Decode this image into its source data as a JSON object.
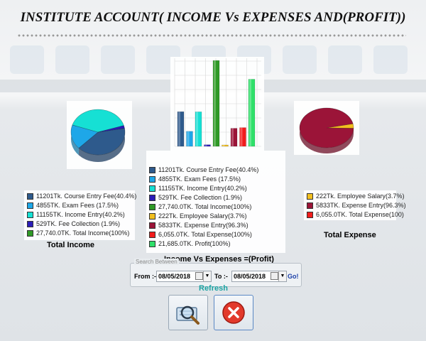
{
  "title": "INSTITUTE ACCOUNT( INCOME Vs EXPENSES AND(PROFIT))",
  "colors": {
    "course_fee": "#2e5a8c",
    "exam_fees": "#1ea7e8",
    "income_entry": "#16e0d4",
    "fee_collection": "#2a1db8",
    "total_income": "#2f9a26",
    "employee_salary": "#f2bf1f",
    "expense_entry": "#9b1438",
    "total_expense": "#f21c1c",
    "profit": "#2fe06a"
  },
  "income_legend": [
    {
      "text": "11201Tk.  Course Entry Fee(40.4%)",
      "color_key": "course_fee"
    },
    {
      "text": "4855TK.  Exam Fees (17.5%)",
      "color_key": "exam_fees"
    },
    {
      "text": "11155TK.  Income Entry(40.2%)",
      "color_key": "income_entry"
    },
    {
      "text": "529TK.  Fee Collection (1.9%)",
      "color_key": "fee_collection"
    },
    {
      "text": "27,740.0TK.  Total Income(100%)",
      "color_key": "total_income"
    }
  ],
  "income_title": "Total Income",
  "center_legend": [
    {
      "text": "11201Tk.  Course Entry Fee(40.4%)",
      "color_key": "course_fee"
    },
    {
      "text": "4855TK.  Exam Fees (17.5%)",
      "color_key": "exam_fees"
    },
    {
      "text": "11155TK.  Income Entry(40.2%)",
      "color_key": "income_entry"
    },
    {
      "text": "529TK.  Fee Collection (1.9%)",
      "color_key": "fee_collection"
    },
    {
      "text": "27,740.0TK.  Total Income(100%)",
      "color_key": "total_income"
    },
    {
      "text": "222Tk.  Employee Salary(3.7%)",
      "color_key": "employee_salary"
    },
    {
      "text": "5833TK.  Expense Entry(96.3%)",
      "color_key": "expense_entry"
    },
    {
      "text": "6,055.0TK.  Total Expense(100%)",
      "color_key": "total_expense"
    },
    {
      "text": "21,685.0TK.  Profit(100%)",
      "color_key": "profit"
    }
  ],
  "center_title": "Income Vs Expenses =(Profit)",
  "expense_legend": [
    {
      "text": "222Tk. Employee Salary(3.7%)",
      "color_key": "employee_salary"
    },
    {
      "text": "5833TK.  Expense Entry(96.3%)",
      "color_key": "expense_entry"
    },
    {
      "text": "6,055.0TK.  Total Expense(100)",
      "color_key": "total_expense"
    }
  ],
  "expense_title": "Total Expense",
  "search": {
    "legend": "Search Between",
    "from_label": "From :-",
    "from_value": "08/05/2018",
    "to_label": "To :-",
    "to_value": "08/05/2018",
    "go_label": "Go!",
    "refresh_label": "Refresh"
  },
  "chart_data": [
    {
      "type": "pie",
      "labels": [
        "Course Entry Fee",
        "Exam Fees",
        "Income Entry",
        "Fee Collection"
      ],
      "values": [
        11201,
        4855,
        11155,
        529
      ]
    },
    {
      "type": "bar",
      "categories": [
        "Course Entry Fee",
        "Exam Fees",
        "Income Entry",
        "Fee Collection",
        "Total Income",
        "Employee Salary",
        "Expense Entry",
        "Total Expense",
        "Profit"
      ],
      "values": [
        11201,
        4855,
        11155,
        529,
        27740,
        222,
        5833,
        6055,
        21685
      ]
    },
    {
      "type": "pie",
      "labels": [
        "Employee Salary",
        "Expense Entry"
      ],
      "values": [
        222,
        5833
      ]
    }
  ]
}
